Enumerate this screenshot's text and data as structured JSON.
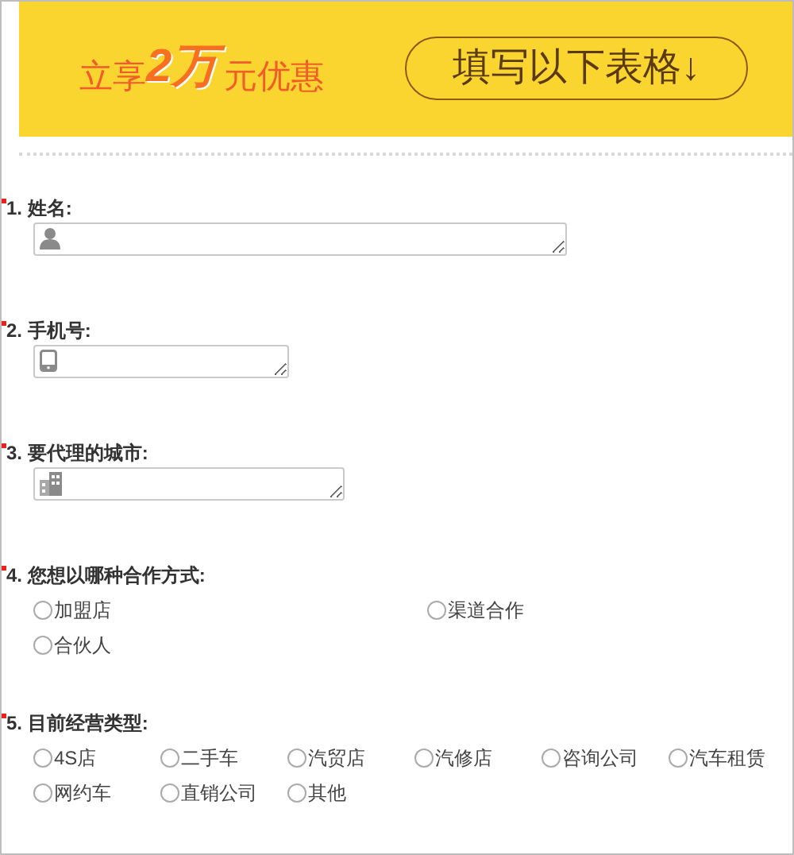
{
  "banner": {
    "prefix": "立享",
    "highlight": "2万",
    "suffix": "元优惠",
    "button": "填写以下表格↓"
  },
  "questions": [
    {
      "kind": "text",
      "required": true,
      "number": "1.",
      "label": "姓名:"
    },
    {
      "kind": "text",
      "required": true,
      "number": "2.",
      "label": "手机号:"
    },
    {
      "kind": "text",
      "required": true,
      "number": "3.",
      "label": "要代理的城市:"
    },
    {
      "kind": "radio",
      "required": true,
      "number": "4.",
      "label": "您想以哪种合作方式:",
      "options": [
        {
          "label": "加盟店",
          "selected": false
        },
        {
          "label": "渠道合作",
          "selected": false
        },
        {
          "label": "合伙人",
          "selected": false
        }
      ]
    },
    {
      "kind": "radio",
      "required": true,
      "number": "5.",
      "label": "目前经营类型:",
      "options": [
        {
          "label": "4S店",
          "selected": false
        },
        {
          "label": "二手车",
          "selected": false
        },
        {
          "label": "汽贸店",
          "selected": false
        },
        {
          "label": "汽修店",
          "selected": false
        },
        {
          "label": "咨询公司",
          "selected": false
        },
        {
          "label": "汽车租赁",
          "selected": false
        },
        {
          "label": "网约车",
          "selected": false
        },
        {
          "label": "直销公司",
          "selected": false
        },
        {
          "label": "其他",
          "selected": false
        }
      ]
    }
  ]
}
